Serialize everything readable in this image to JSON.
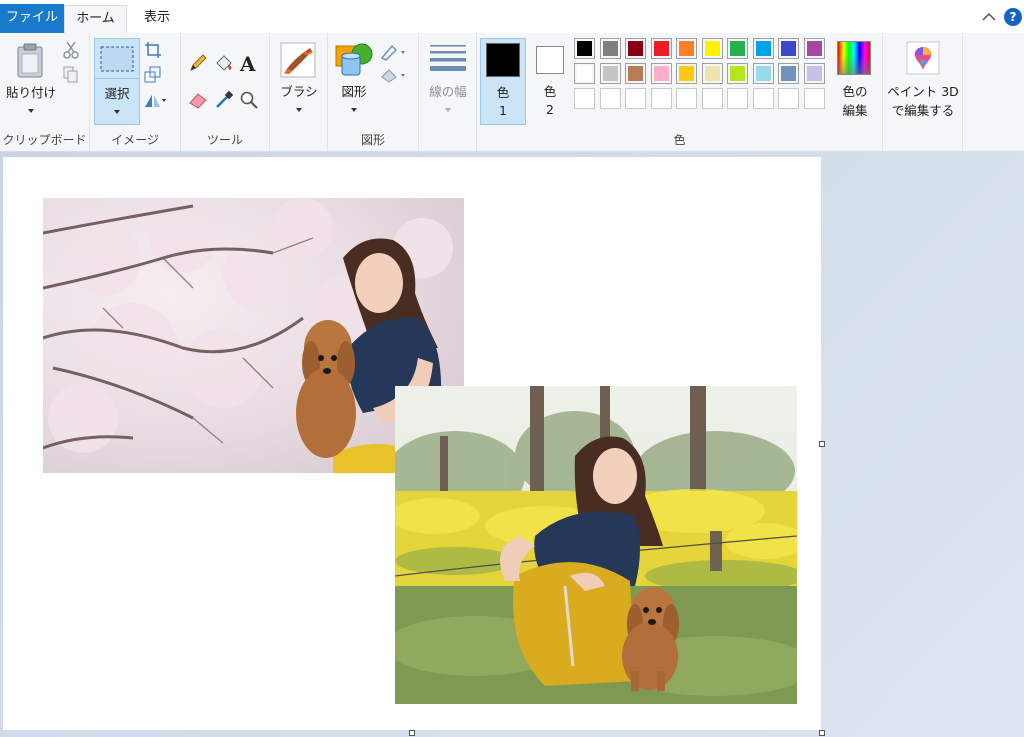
{
  "tabs": {
    "file": "ファイル",
    "home": "ホーム",
    "view": "表示"
  },
  "help": "?",
  "groups": {
    "clipboard": {
      "label": "クリップボード",
      "paste": "貼り付け"
    },
    "image": {
      "label": "イメージ",
      "select": "選択"
    },
    "tools": {
      "label": "ツール"
    },
    "brush": {
      "label": "ブラシ"
    },
    "shapes": {
      "label": "図形",
      "shapes_button": "図形"
    },
    "size": {
      "label": "線の幅"
    },
    "colors": {
      "label": "色",
      "color1_a": "色",
      "color1_b": "1",
      "color2_a": "色",
      "color2_b": "2",
      "edit_a": "色の",
      "edit_b": "編集",
      "color1_value": "#000000",
      "color2_value": "#ffffff",
      "palette_row1": [
        "#000000",
        "#7f7f7f",
        "#880015",
        "#ed1c24",
        "#ff7f27",
        "#fff200",
        "#22b14c",
        "#00a2e8",
        "#3f48cc",
        "#a349a4"
      ],
      "palette_row2": [
        "#ffffff",
        "#c3c3c3",
        "#b97a57",
        "#ffaec9",
        "#ffc90e",
        "#efe4b0",
        "#b5e61d",
        "#99d9ea",
        "#7092be",
        "#c8bfe7"
      ],
      "palette_row3": [
        "",
        "",
        "",
        "",
        "",
        "",
        "",
        "",
        "",
        ""
      ]
    },
    "paint3d": {
      "line1": "ペイント 3D",
      "line2": "で編集する"
    }
  },
  "canvas": {
    "photo1": "cherry-blossom-woman-dog-photo",
    "photo2": "rapeseed-field-woman-dog-photo"
  }
}
